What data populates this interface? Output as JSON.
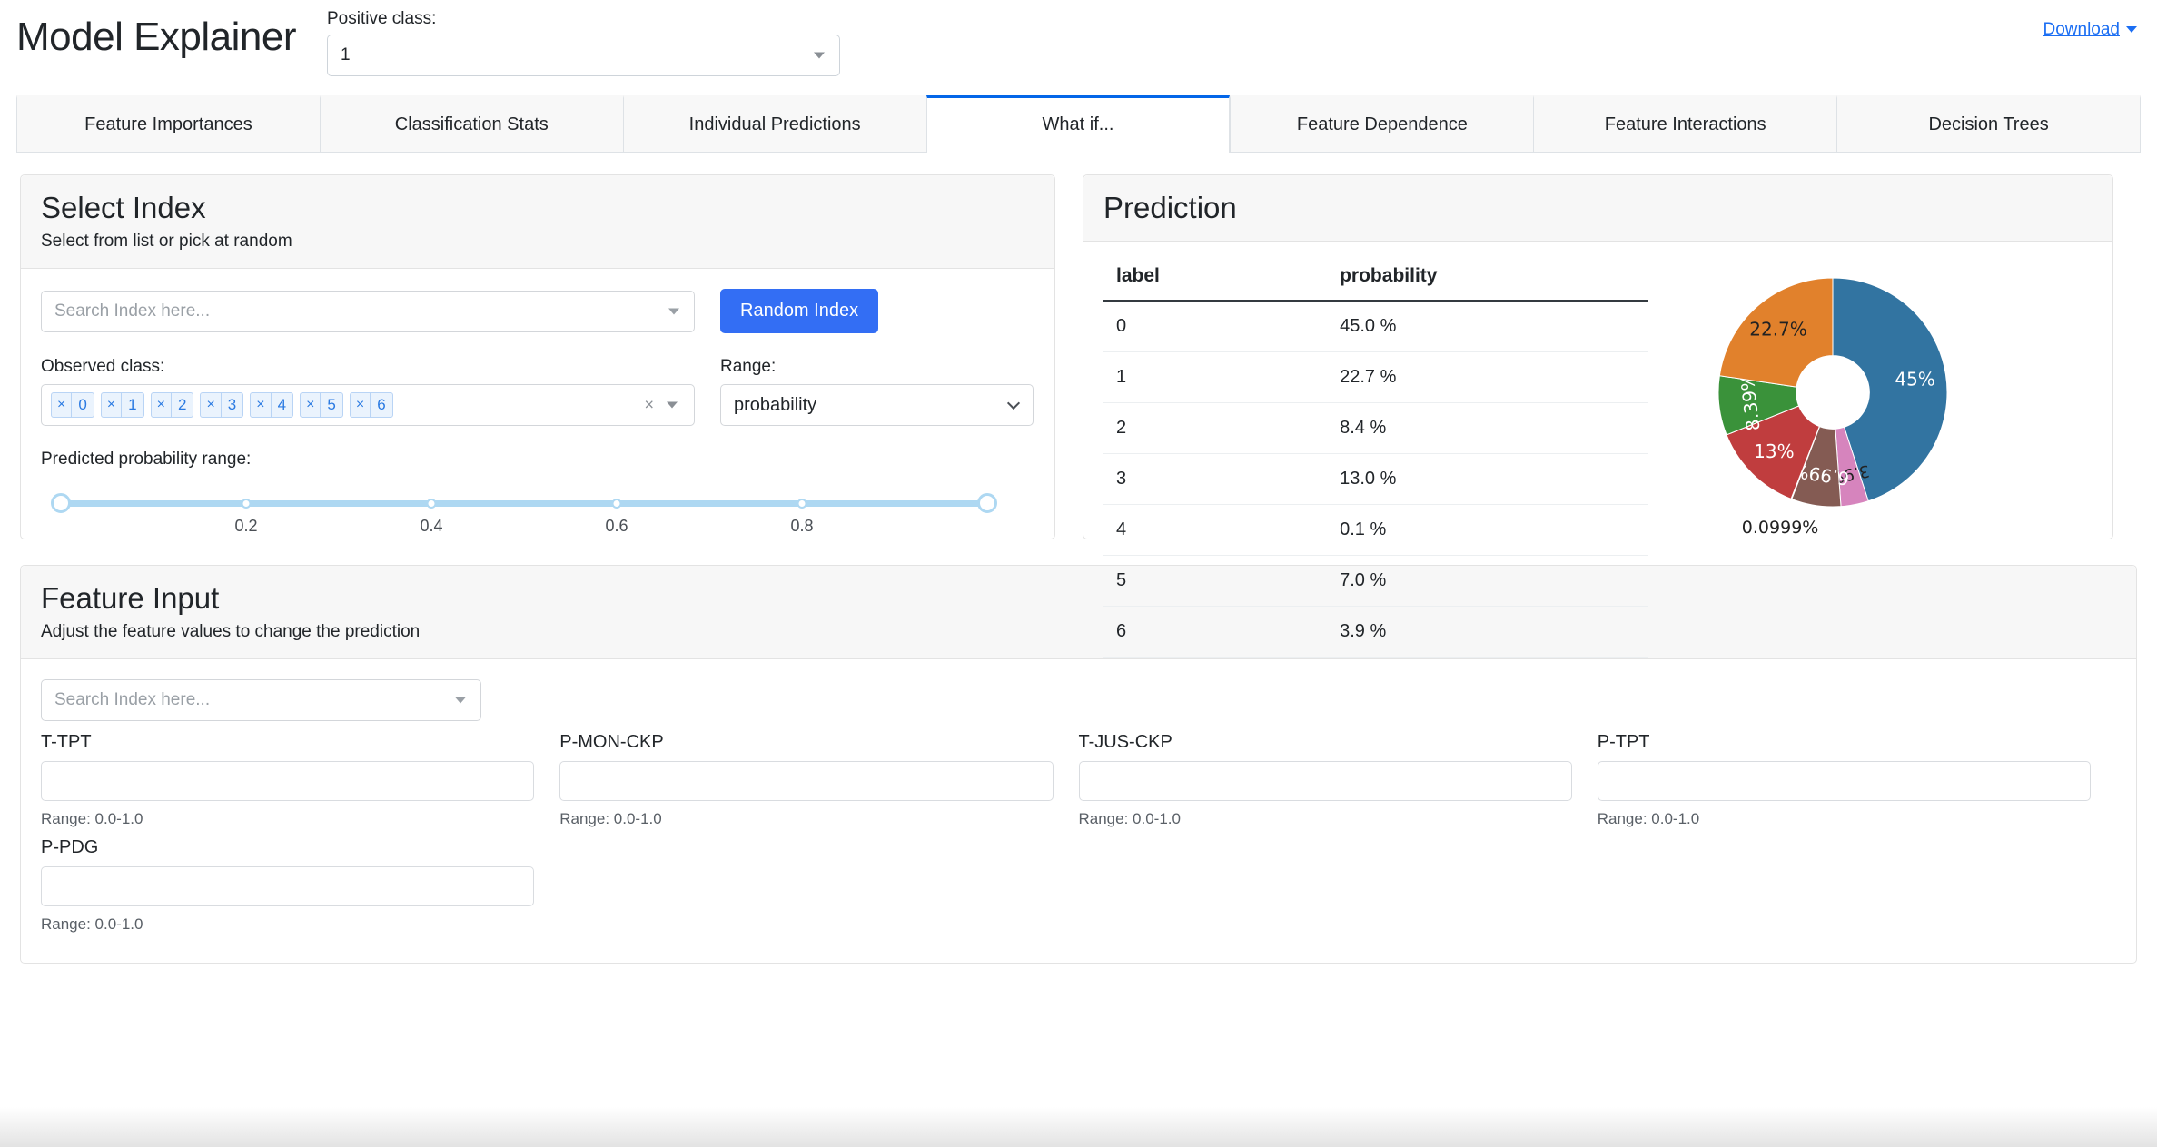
{
  "header": {
    "app_title": "Model Explainer",
    "positive_class_label": "Positive class:",
    "positive_class_value": "1",
    "download_label": "Download"
  },
  "tabs": [
    {
      "label": "Feature Importances",
      "active": false
    },
    {
      "label": "Classification Stats",
      "active": false
    },
    {
      "label": "Individual Predictions",
      "active": false
    },
    {
      "label": "What if...",
      "active": true
    },
    {
      "label": "Feature Dependence",
      "active": false
    },
    {
      "label": "Feature Interactions",
      "active": false
    },
    {
      "label": "Decision Trees",
      "active": false
    }
  ],
  "select_index": {
    "title": "Select Index",
    "subtitle": "Select from list or pick at random",
    "search_placeholder": "Search Index here...",
    "random_index_button": "Random Index",
    "observed_class_label": "Observed class:",
    "observed_class_chips": [
      "0",
      "1",
      "2",
      "3",
      "4",
      "5",
      "6"
    ],
    "chip_remove_glyph": "×",
    "clear_all_glyph": "×",
    "range_label": "Range:",
    "range_value": "probability",
    "slider_label": "Predicted probability range:",
    "slider_ticks": [
      "0.2",
      "0.4",
      "0.6",
      "0.8"
    ],
    "slider_min": 0,
    "slider_max": 1,
    "slider_low": 0,
    "slider_high": 1
  },
  "prediction": {
    "title": "Prediction",
    "columns": [
      "label",
      "probability"
    ],
    "rows": [
      {
        "label": "0",
        "probability": "45.0 %"
      },
      {
        "label": "1",
        "probability": "22.7 %"
      },
      {
        "label": "2",
        "probability": "8.4 %"
      },
      {
        "label": "3",
        "probability": "13.0 %"
      },
      {
        "label": "4",
        "probability": "0.1 %"
      },
      {
        "label": "5",
        "probability": "7.0 %"
      },
      {
        "label": "6",
        "probability": "3.9 %"
      }
    ]
  },
  "chart_data": {
    "type": "pie",
    "title": "",
    "donut": true,
    "hole_ratio": 0.32,
    "start_angle_deg": 90,
    "direction": "clockwise",
    "labels": [
      "0",
      "1",
      "2",
      "3",
      "4",
      "5",
      "6"
    ],
    "values": [
      45.0,
      22.7,
      8.39,
      13.0,
      0.0999,
      6.99,
      3.9
    ],
    "data_labels": [
      "45%",
      "22.7%",
      "8.39%",
      "13%",
      "0.0999%",
      "6.99%",
      "3.9%"
    ],
    "colors": [
      "#3274a1",
      "#e1812c",
      "#3a923a",
      "#c03d3e",
      "#9372b2",
      "#845b53",
      "#d684bd"
    ],
    "label_text_colors": [
      "#ffffff",
      "#222222",
      "#ffffff",
      "#ffffff",
      "#222222",
      "#ffffff",
      "#222222"
    ],
    "draw_order_clockwise_from_top": [
      "0",
      "6",
      "5",
      "4",
      "3",
      "2",
      "1"
    ],
    "legend": "none"
  },
  "feature_input": {
    "title": "Feature Input",
    "subtitle": "Adjust the feature values to change the prediction",
    "search_placeholder": "Search Index here...",
    "fields": [
      {
        "name": "T-TPT",
        "value": "",
        "range": "Range: 0.0-1.0"
      },
      {
        "name": "P-MON-CKP",
        "value": "",
        "range": "Range: 0.0-1.0"
      },
      {
        "name": "T-JUS-CKP",
        "value": "",
        "range": "Range: 0.0-1.0"
      },
      {
        "name": "P-TPT",
        "value": "",
        "range": "Range: 0.0-1.0"
      },
      {
        "name": "P-PDG",
        "value": "",
        "range": "Range: 0.0-1.0"
      }
    ]
  },
  "theme": {
    "accent_blue": "#336ef4",
    "tab_active_border": "#0366e8",
    "link_blue": "#1b6ef3",
    "slider_blue": "#aed8f2",
    "card_header_bg": "#f7f7f7",
    "card_border": "#e3e3e3"
  }
}
